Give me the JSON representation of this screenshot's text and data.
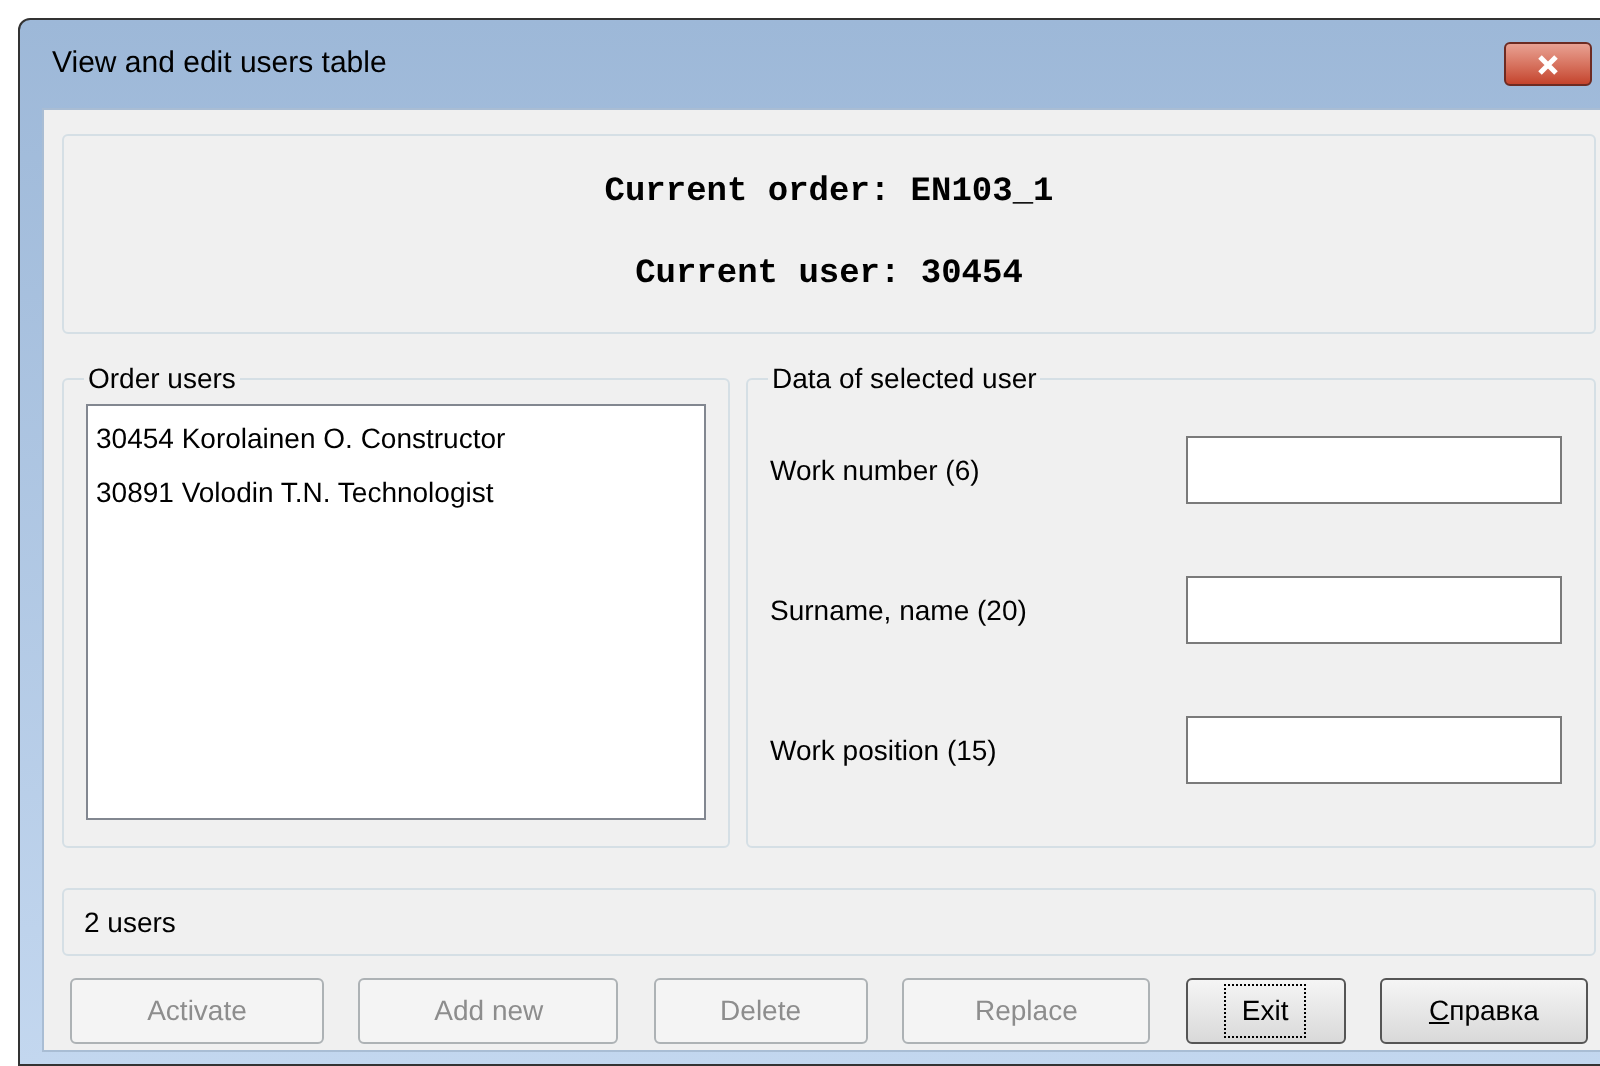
{
  "window": {
    "title": "View and edit users table"
  },
  "header": {
    "lines": [
      "Current order: EN103_1",
      "Current user: 30454"
    ]
  },
  "order_users": {
    "title": "Order users",
    "items": [
      {
        "label": "30454 Korolainen O. Constructor",
        "selected": false
      },
      {
        "label": "30891 Volodin T.N. Technologist",
        "selected": false
      }
    ]
  },
  "selected_user": {
    "title": "Data of selected user",
    "fields": [
      {
        "label": "Work number (6)"
      },
      {
        "label": "Surname, name (20)"
      },
      {
        "label": "Work position (15)"
      }
    ]
  },
  "status_bar": "2 users",
  "buttons": [
    {
      "label": "Activate",
      "disabled": true,
      "focused": false
    },
    {
      "label": "Add new",
      "disabled": true,
      "focused": false
    },
    {
      "label": "Delete",
      "disabled": true,
      "focused": false
    },
    {
      "label": "Replace",
      "disabled": true,
      "focused": false
    },
    {
      "label": "Exit",
      "disabled": false,
      "focused": true
    },
    {
      "label": "Справка",
      "disabled": false,
      "focused": false,
      "first_letter_underlined": true
    }
  ]
}
